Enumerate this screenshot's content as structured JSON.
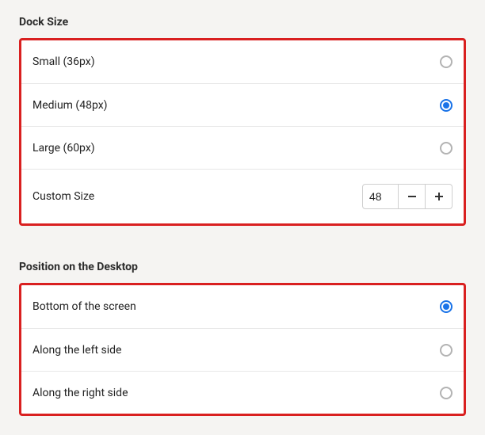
{
  "dock_size": {
    "title": "Dock Size",
    "options": [
      {
        "label": "Small (36px)",
        "selected": false
      },
      {
        "label": "Medium (48px)",
        "selected": true
      },
      {
        "label": "Large (60px)",
        "selected": false
      }
    ],
    "custom": {
      "label": "Custom Size",
      "value": "48"
    }
  },
  "position": {
    "title": "Position on the Desktop",
    "options": [
      {
        "label": "Bottom of the screen",
        "selected": true
      },
      {
        "label": "Along the left side",
        "selected": false
      },
      {
        "label": "Along the right side",
        "selected": false
      }
    ]
  }
}
